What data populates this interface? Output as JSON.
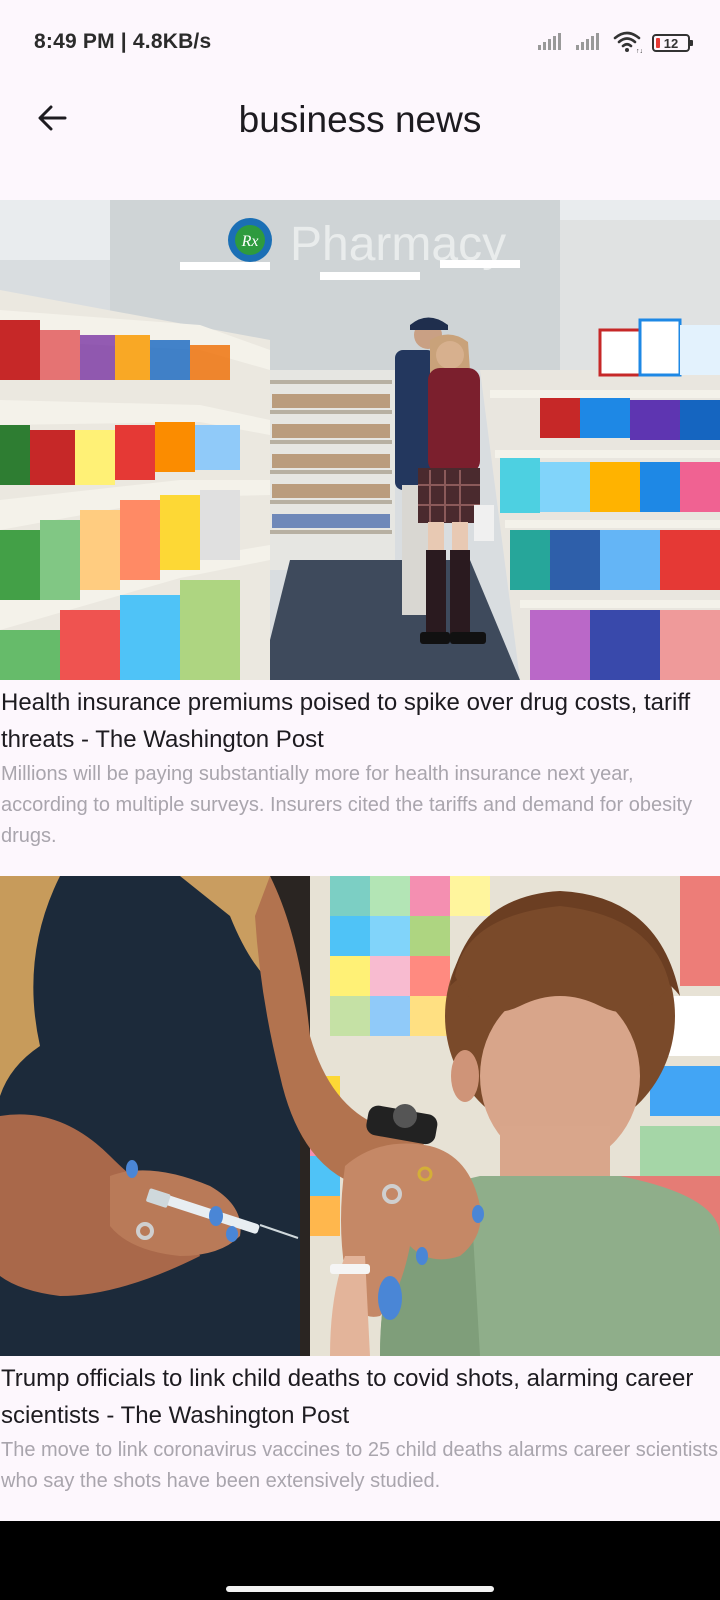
{
  "status_bar": {
    "time": "8:49 PM | 4.8KB/s",
    "battery": "12",
    "icons": [
      "signal-icon",
      "signal-icon",
      "wifi-icon",
      "battery-icon"
    ]
  },
  "app_bar": {
    "title": "business news",
    "back_icon": "arrow-left-icon"
  },
  "articles": [
    {
      "image_desc": "pharmacy-photo",
      "sign_text": "Pharmacy",
      "title": "Health insurance premiums poised to spike over drug costs, tariff threats - The Washington Post",
      "description": "Millions will be paying substantially more for health insurance next year, according to multiple surveys. Insurers cited the tariffs and demand for obesity drugs."
    },
    {
      "image_desc": "vaccination-photo",
      "title": "Trump officials to link child deaths to covid shots, alarming career scientists - The Washington Post",
      "description": "The move to link coronavirus vaccines to 25 child deaths alarms career scientists who say the shots have been extensively studied."
    }
  ],
  "colors": {
    "background": "#fdf7fd",
    "title_text": "#1d1b20",
    "desc_text": "#a9a5ad",
    "nav_bar": "#000000"
  }
}
